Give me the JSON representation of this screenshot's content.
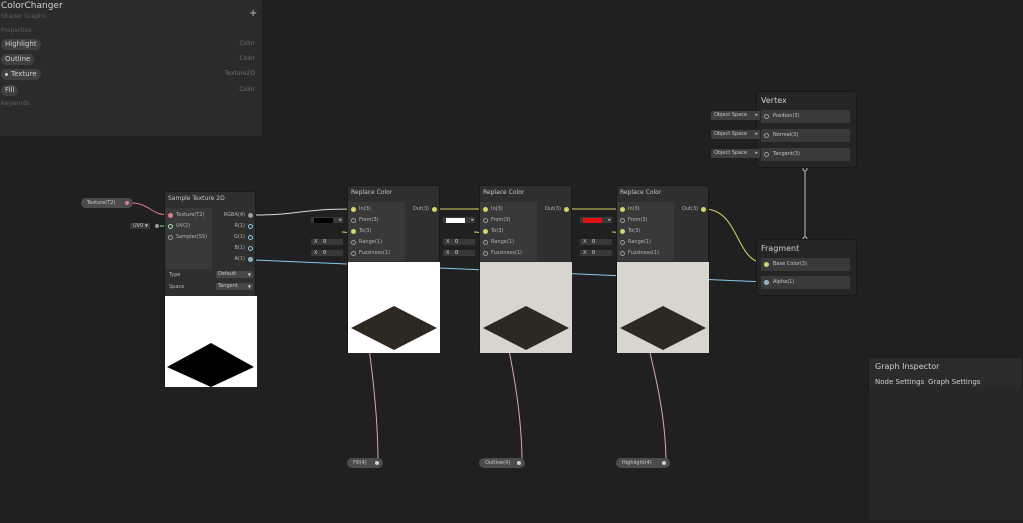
{
  "blackboard": {
    "title": "ColorChanger",
    "subtitle": "Shader Graphs",
    "add_label": "+",
    "properties_header": "Properties",
    "keywords_header": "Keywords",
    "properties": [
      {
        "name": "Highlight",
        "type": "Color"
      },
      {
        "name": "Outline",
        "type": "Color"
      },
      {
        "name": "Texture",
        "type": "Texture2D"
      },
      {
        "name": "Fill",
        "type": "Color"
      }
    ]
  },
  "sample_texture": {
    "title": "Sample Texture 2D",
    "inputs": [
      "Texture(T2)",
      "UV(2)",
      "Sampler(SS)"
    ],
    "outputs": [
      "RGBA(4)",
      "R(1)",
      "G(1)",
      "B(1)",
      "A(1)"
    ],
    "type_label": "Type",
    "type_value": "Default",
    "space_label": "Space",
    "space_value": "Tangent"
  },
  "uv_field": "UV0",
  "texture_pill": "Texture(T2)",
  "replace_color": {
    "title": "Replace Color",
    "inputs": [
      "In(3)",
      "From(3)",
      "To(3)",
      "Range(1)",
      "Fuzziness(1)"
    ],
    "output": "Out(3)",
    "x_label": "X",
    "x_value": "0"
  },
  "replace_nodes": [
    {
      "from_color": "#000000",
      "preview_bg": "#ffffff",
      "out_pill": "Fill(4)"
    },
    {
      "from_color": "#ffffff",
      "preview_bg": "#d8d5cf",
      "out_pill": "Outline(4)"
    },
    {
      "from_color": "#e01010",
      "preview_bg": "#d8d5cf",
      "out_pill": "Highlight(4)"
    }
  ],
  "vertex": {
    "title": "Vertex",
    "blocks": [
      "Position(3)",
      "Normal(3)",
      "Tangent(3)"
    ],
    "spaces": [
      "Object Space",
      "Object Space",
      "Object Space"
    ]
  },
  "fragment": {
    "title": "Fragment",
    "blocks": [
      "Base Color(3)",
      "Alpha(1)"
    ]
  },
  "inspector": {
    "title": "Graph Inspector",
    "tabs": [
      "Node Settings",
      "Graph Settings"
    ]
  },
  "colors": {
    "background": "#202020",
    "wire_color": "#d6d36a",
    "wire_texture": "#e07b8c",
    "wire_float": "#88c9e8",
    "wire_vector": "#d8d8d8"
  }
}
